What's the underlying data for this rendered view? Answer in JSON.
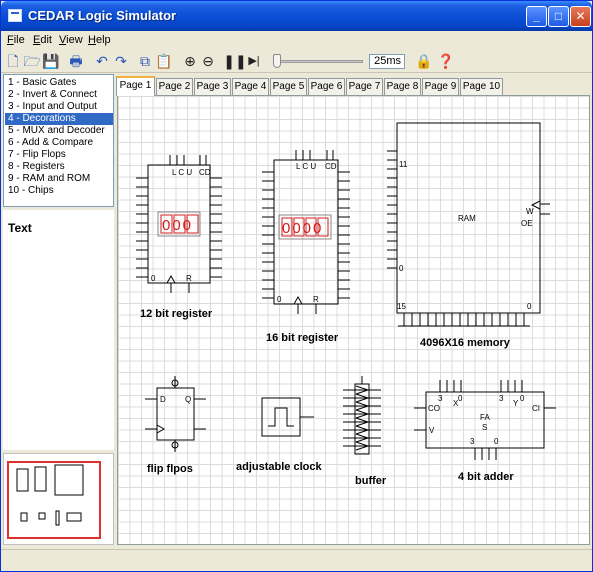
{
  "window": {
    "title": "CEDAR Logic Simulator"
  },
  "menu": [
    "File",
    "Edit",
    "View",
    "Help"
  ],
  "toolbar": {
    "speed_value": "25ms"
  },
  "gate_categories": [
    "1 - Basic Gates",
    "2 - Invert & Connect",
    "3 - Input and Output",
    "4 - Decorations",
    "5 - MUX and Decoder",
    "6 - Add & Compare",
    "7 - Flip Flops",
    "8 - Registers",
    "9 - RAM and ROM",
    "10 - Chips"
  ],
  "selected_category": "4 - Decorations",
  "text_panel": {
    "label": "Text"
  },
  "tabs": [
    "Page 1",
    "Page 2",
    "Page 3",
    "Page 4",
    "Page 5",
    "Page 6",
    "Page 7",
    "Page 8",
    "Page 9",
    "Page 10"
  ],
  "active_tab": "Page 1",
  "canvas": {
    "reg12": {
      "top": "L C U",
      "ctrl": "CD",
      "display": "000",
      "label": "12 bit register",
      "pin_r": "R",
      "pin_d": "0"
    },
    "reg16": {
      "top": "L C U",
      "ctrl": "CD",
      "display": "0000",
      "label": "16 bit register",
      "pin_r": "R",
      "pin_d": "0"
    },
    "ram": {
      "name": "RAM",
      "label": "4096X16 memory",
      "pin_w": "W",
      "pin_oe": "OE",
      "pin_11": "11",
      "pin_15": "15",
      "pin_0l": "0",
      "pin_0b": "0"
    },
    "flipflop": {
      "label": "flip flpos",
      "pin_d": "D",
      "pin_q": "Q"
    },
    "clock": {
      "label": "adjustable clock"
    },
    "buffer": {
      "label": "buffer"
    },
    "adder": {
      "label": "4 bit adder",
      "name": "FA",
      "pin_s": "S",
      "pin_x": "X",
      "pin_y": "Y",
      "pin_co": "CO",
      "pin_ci": "CI",
      "pin_v": "V",
      "n3a": "3",
      "n0a": "0",
      "n3b": "3",
      "n0b": "0",
      "n3c": "3",
      "n0c": "0"
    }
  }
}
